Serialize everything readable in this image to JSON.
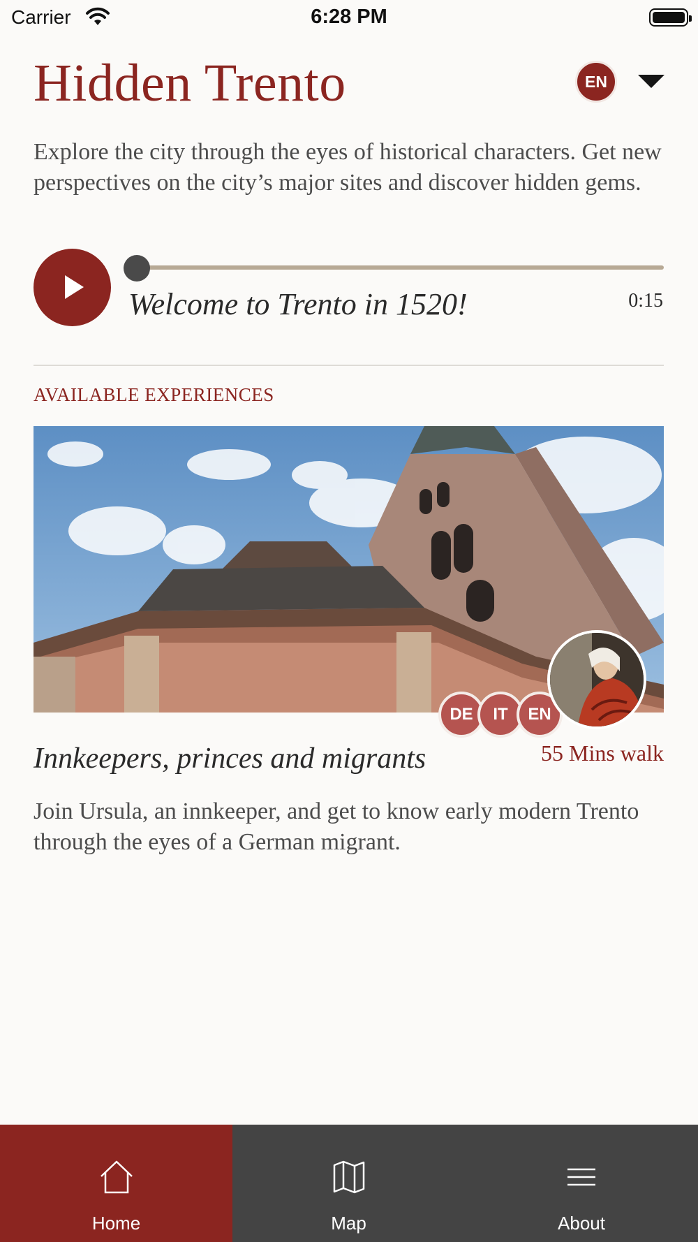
{
  "status_bar": {
    "carrier": "Carrier",
    "time": "6:28 PM"
  },
  "header": {
    "title": "Hidden Trento",
    "language": "EN"
  },
  "intro": "Explore the city through the eyes of historical characters. Get new perspectives on the city’s major sites and discover hidden gems.",
  "audio": {
    "title": "Welcome to Trento in 1520!",
    "duration": "0:15",
    "progress": 0
  },
  "section_label": "AVAILABLE EXPERIENCES",
  "experience": {
    "title": "Innkeepers, princes and migrants",
    "duration": "55 Mins walk",
    "description": "Join Ursula, an innkeeper, and get to know early modern Trento through the eyes of a German migrant.",
    "languages": [
      "DE",
      "IT",
      "EN"
    ]
  },
  "tabs": [
    {
      "label": "Home",
      "icon": "home-icon",
      "active": true
    },
    {
      "label": "Map",
      "icon": "map-icon",
      "active": false
    },
    {
      "label": "About",
      "icon": "menu-icon",
      "active": false
    }
  ],
  "colors": {
    "accent": "#8b2520",
    "tabbar": "#444444",
    "background": "#fbfaf8"
  }
}
